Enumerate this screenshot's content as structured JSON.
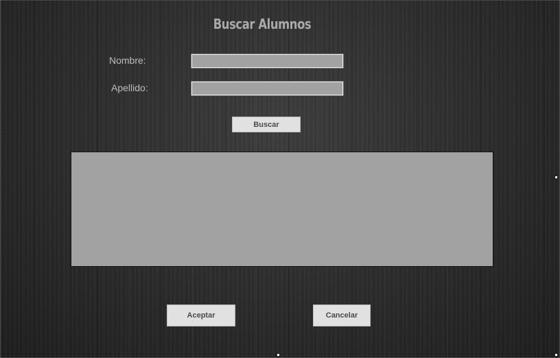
{
  "form": {
    "title": "Buscar Alumnos",
    "nombre_label": "Nombre:",
    "nombre_value": "",
    "apellido_label": "Apellido:",
    "apellido_value": "",
    "buscar_label": "Buscar",
    "aceptar_label": "Aceptar",
    "cancelar_label": "Cancelar"
  },
  "colors": {
    "background": "#2f2f2f",
    "input_fill": "#a2a2a2",
    "grid_fill": "#a2a2a2",
    "button_fill": "#e1e1e1",
    "label_text": "#bdbdbd"
  },
  "icons": [
    "resize-handle-icon"
  ]
}
